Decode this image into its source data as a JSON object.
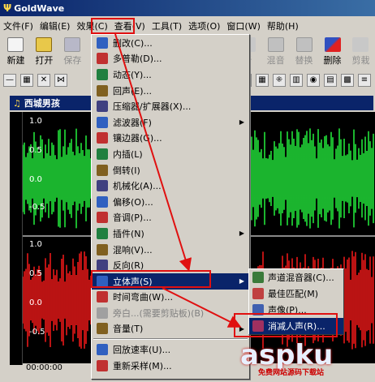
{
  "app": {
    "title": "GoldWave",
    "logo_glyph": "Ψ"
  },
  "menubar": [
    "文件(F)",
    "编辑(E)",
    "效果(C)",
    "查看(V)",
    "工具(T)",
    "选项(O)",
    "窗口(W)",
    "帮助(H)"
  ],
  "toolbar": {
    "left": [
      {
        "label": "新建",
        "icon": "new-file-icon",
        "disabled": false
      },
      {
        "label": "打开",
        "icon": "open-folder-icon",
        "disabled": false
      },
      {
        "label": "保存",
        "icon": "save-icon",
        "disabled": true
      }
    ],
    "right": [
      {
        "label": "新",
        "icon": "new-icon",
        "disabled": true
      },
      {
        "label": "混音",
        "icon": "mix-icon",
        "disabled": true
      },
      {
        "label": "替换",
        "icon": "replace-icon",
        "disabled": true
      },
      {
        "label": "删除",
        "icon": "delete-icon",
        "disabled": false
      },
      {
        "label": "剪栽",
        "icon": "trim-icon",
        "disabled": true
      }
    ]
  },
  "document": {
    "title": "西城男孩"
  },
  "waveform": {
    "labels": [
      "1.0",
      "0.5",
      "0.0",
      "-0.5",
      "1.0",
      "0.5",
      "0.0",
      "-0.5"
    ],
    "time_start": "00:00:00",
    "colors": {
      "top": "#22e23a",
      "bottom": "#e81818",
      "background": "#000000"
    }
  },
  "effects_menu": {
    "items": [
      {
        "label": "删改(C)...",
        "icon": "cut-icon",
        "sub": false,
        "disabled": false
      },
      {
        "label": "多普勒(D)...",
        "icon": "doppler-icon",
        "sub": false,
        "disabled": false
      },
      {
        "label": "动态(Y)...",
        "icon": "dynamics-icon",
        "sub": false,
        "disabled": false
      },
      {
        "label": "回声(E)...",
        "icon": "echo-icon",
        "sub": false,
        "disabled": false
      },
      {
        "label": "压缩器/扩展器(X)...",
        "icon": "compressor-icon",
        "sub": false,
        "disabled": false
      },
      {
        "label": "滤波器(F)",
        "icon": "filter-icon",
        "sub": true,
        "disabled": false
      },
      {
        "label": "镶边器(G)...",
        "icon": "flanger-icon",
        "sub": false,
        "disabled": false
      },
      {
        "label": "内插(L)",
        "icon": "interpolate-icon",
        "sub": false,
        "disabled": false
      },
      {
        "label": "倒转(I)",
        "icon": "invert-icon",
        "sub": false,
        "disabled": false
      },
      {
        "label": "机械化(A)...",
        "icon": "mechanize-icon",
        "sub": false,
        "disabled": false
      },
      {
        "label": "偏移(O)...",
        "icon": "offset-icon",
        "sub": false,
        "disabled": false
      },
      {
        "label": "音调(P)...",
        "icon": "pitch-icon",
        "sub": false,
        "disabled": false
      },
      {
        "label": "插件(N)",
        "icon": "plugin-icon",
        "sub": true,
        "disabled": false
      },
      {
        "label": "混响(V)...",
        "icon": "reverb-icon",
        "sub": false,
        "disabled": false
      },
      {
        "label": "反向(R)",
        "icon": "reverse-icon",
        "sub": false,
        "disabled": false
      },
      {
        "label": "立体声(S)",
        "icon": "stereo-icon",
        "sub": true,
        "disabled": false,
        "highlighted": true
      },
      {
        "label": "时间弯曲(W)...",
        "icon": "time-warp-icon",
        "sub": false,
        "disabled": false
      },
      {
        "label": "旁白...(需要剪贴板)(B)",
        "icon": "voice-over-icon",
        "sub": false,
        "disabled": true
      },
      {
        "label": "音量(T)",
        "icon": "volume-icon",
        "sub": true,
        "disabled": false
      },
      {
        "sep": true
      },
      {
        "label": "回放速率(U)...",
        "icon": "playback-rate-icon",
        "sub": false,
        "disabled": false
      },
      {
        "label": "重新采样(M)...",
        "icon": "resample-icon",
        "sub": false,
        "disabled": false
      }
    ]
  },
  "stereo_submenu": {
    "items": [
      {
        "label": "声道混音器(C)...",
        "icon": "channel-mixer-icon"
      },
      {
        "label": "最佳匹配(M)",
        "icon": "match-icon"
      },
      {
        "label": "声像(P)...",
        "icon": "pan-icon"
      },
      {
        "label": "消减人声(R)...",
        "icon": "reduce-vocal-icon",
        "highlighted": true
      }
    ]
  },
  "watermark": {
    "main": "aspku",
    "small": "免费网站源码下载站"
  }
}
